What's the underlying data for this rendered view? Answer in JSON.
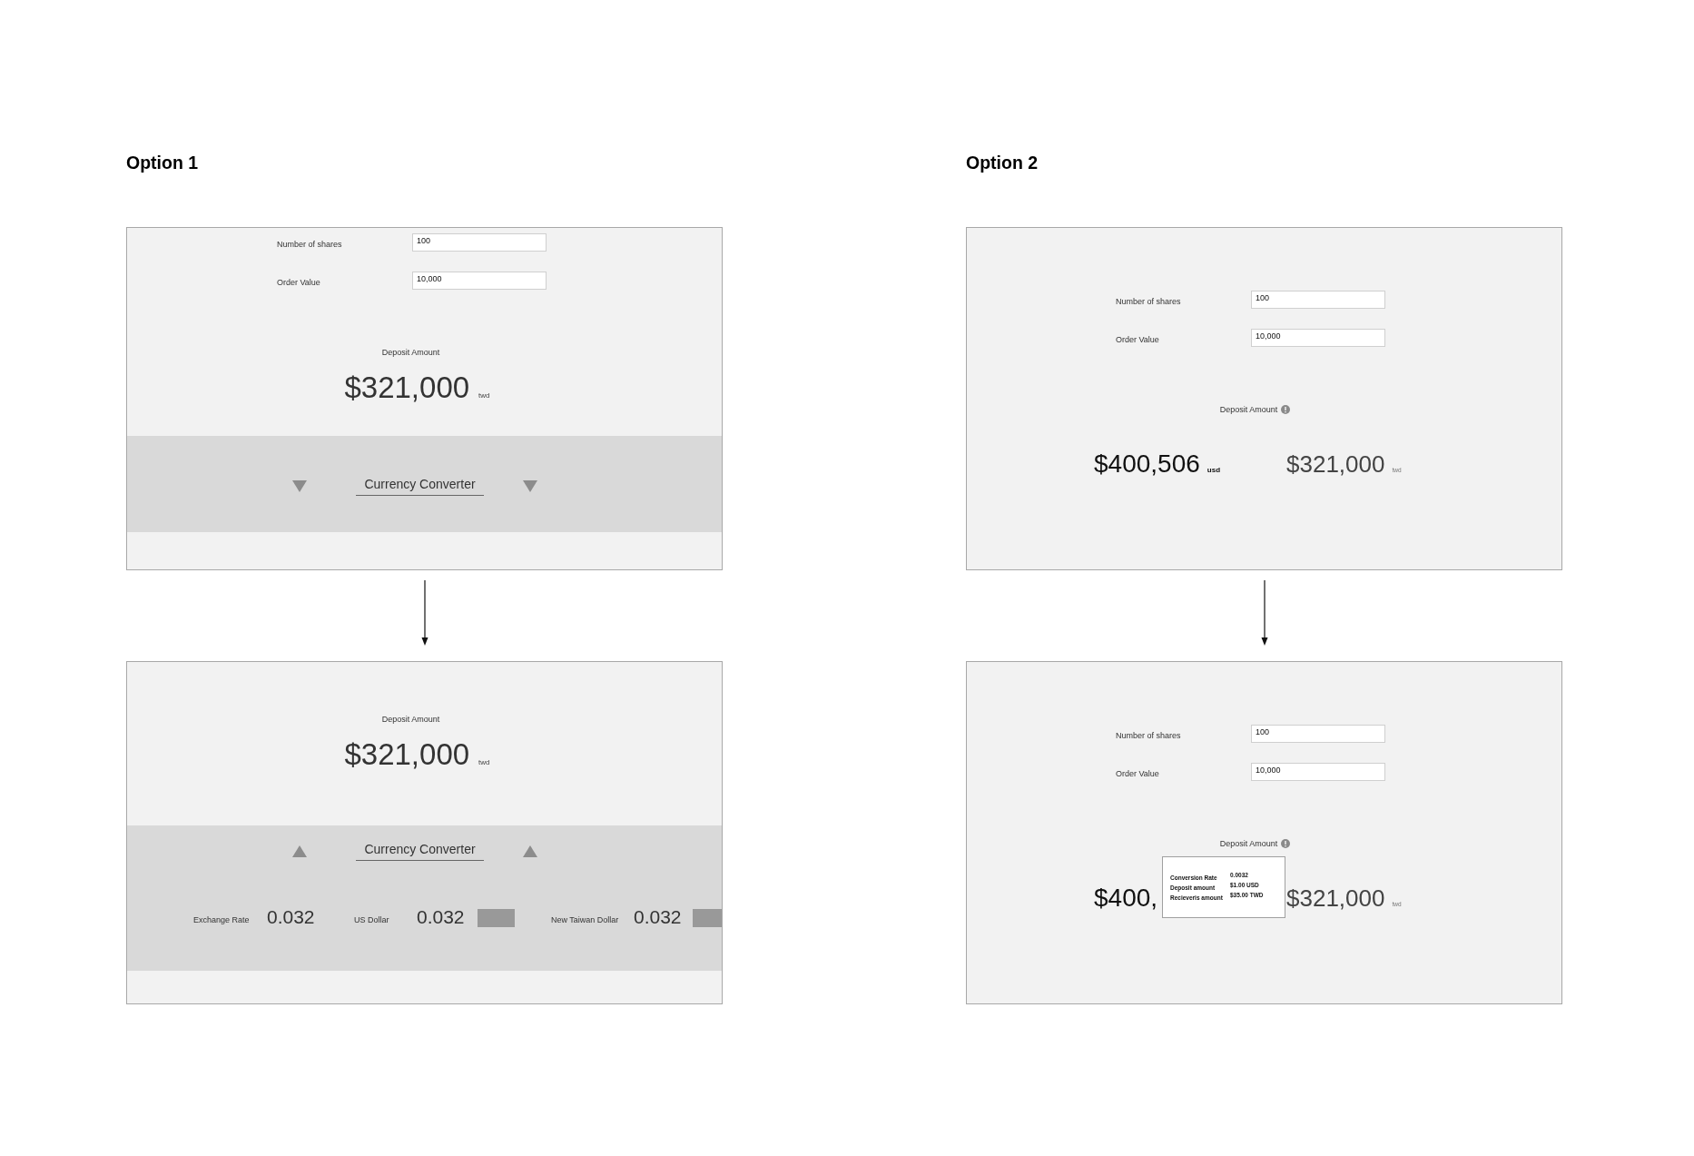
{
  "options": [
    {
      "title": "Option 1",
      "screens": [
        {
          "kind": "converter",
          "fields": [
            {
              "label": "Number of shares",
              "value": "100"
            },
            {
              "label": "Order Value",
              "value": "10,000"
            }
          ],
          "deposit": {
            "label": "Deposit Amount",
            "amount": "$321,000",
            "currency": "twd"
          },
          "converter": {
            "label": "Currency Converter",
            "expanded": false
          }
        },
        {
          "kind": "converter",
          "deposit": {
            "label": "Deposit Amount",
            "amount": "$321,000",
            "currency": "twd"
          },
          "converter": {
            "label": "Currency Converter",
            "expanded": true,
            "rates": [
              {
                "kind": "rate",
                "label": "Exchange Rate",
                "value": "0.032"
              },
              {
                "kind": "currency",
                "label": "US Dollar",
                "value": "0.032"
              },
              {
                "kind": "currency",
                "label": "New Taiwan Dollar",
                "value": "0.032"
              }
            ]
          }
        }
      ]
    },
    {
      "title": "Option 2",
      "screens": [
        {
          "kind": "dual",
          "fields": [
            {
              "label": "Number of shares",
              "value": "100"
            },
            {
              "label": "Order Value",
              "value": "10,000"
            }
          ],
          "deposit": {
            "label": "Deposit Amount",
            "amounts": [
              {
                "amount": "$400,506",
                "currency": "usd"
              },
              {
                "amount": "$321,000",
                "currency": "twd"
              }
            ]
          }
        },
        {
          "kind": "dual",
          "fields": [
            {
              "label": "Number of shares",
              "value": "100"
            },
            {
              "label": "Order Value",
              "value": "10,000"
            }
          ],
          "deposit": {
            "label": "Deposit Amount",
            "amounts": [
              {
                "amount": "$400,"
              },
              {
                "amount": "$321,000",
                "currency": "twd"
              }
            ],
            "tooltip": {
              "rows": [
                {
                  "label": "Conversion Rate",
                  "value": "0.0032"
                },
                {
                  "label": "Deposit amount",
                  "value": "$1.00 USD"
                },
                {
                  "label": "Recieveris amount",
                  "value": "$35.00 TWD"
                }
              ]
            }
          }
        }
      ]
    }
  ]
}
